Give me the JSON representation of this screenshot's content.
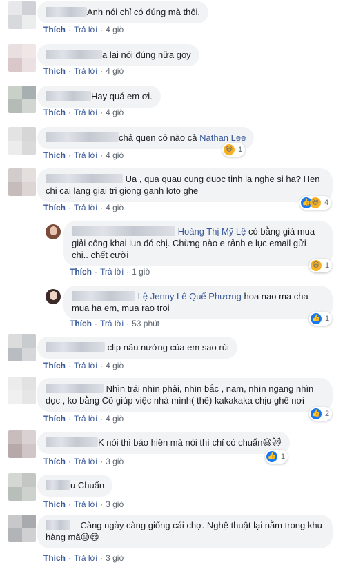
{
  "actions": {
    "like": "Thích",
    "reply": "Trả lời"
  },
  "comments": [
    {
      "text": "Anh nói chỉ có đúng mà thôi.",
      "time": "4 giờ"
    },
    {
      "text": "a lại nói đúng nữa goy",
      "time": "4 giờ"
    },
    {
      "text": "Hay quá em ơi.",
      "time": "4 giờ"
    },
    {
      "text": "chả quen cô nào cả",
      "mention": "Nathan Lee",
      "time": "4 giờ",
      "reaction_count": "1"
    },
    {
      "text": "Ua , qua quau cung duoc tinh la nghe si ha? Hen chi cai lang giai tri giong ganh loto ghe",
      "time": "4 giờ",
      "reaction_count": "4"
    },
    {
      "mention": "Hoàng Thị Mỹ Lệ",
      "text": " có bằng giá mua giải công khai lun đó chị. Chừng nào e rảnh e lục email gửi chị.. chết cười",
      "time": "1 giờ",
      "reaction_count": "1"
    },
    {
      "author_suffix": "Lệ",
      "mention": "Jenny Lê Quế Phương",
      "text": " hoa nao ma cha mua ha em, mua rao troi",
      "time": "53 phút",
      "reaction_count": "1"
    },
    {
      "text": "clip nấu nướng của em sao rùi",
      "time": "4 giờ"
    },
    {
      "text": "Nhìn trái nhìn phải, nhìn bắc , nam, nhìn ngang nhìn dọc , ko bằng Cô giúp việc nhà mình( thề) kakakaka chịu ghê nơi",
      "time": "4 giờ",
      "reaction_count": "2"
    },
    {
      "text": "K nói thì bảo hiền mà nói thì chỉ có chuẩn",
      "emoji": "😆😻",
      "time": "3 giờ",
      "reaction_count": "1"
    },
    {
      "text": "u Chuẩn",
      "time": "3 giờ"
    },
    {
      "text": "Càng ngày càng giống cái chợ. Nghệ thuật lại nằm trong khu hàng mã",
      "emoji": "😑😌",
      "time": "3 giờ"
    }
  ]
}
